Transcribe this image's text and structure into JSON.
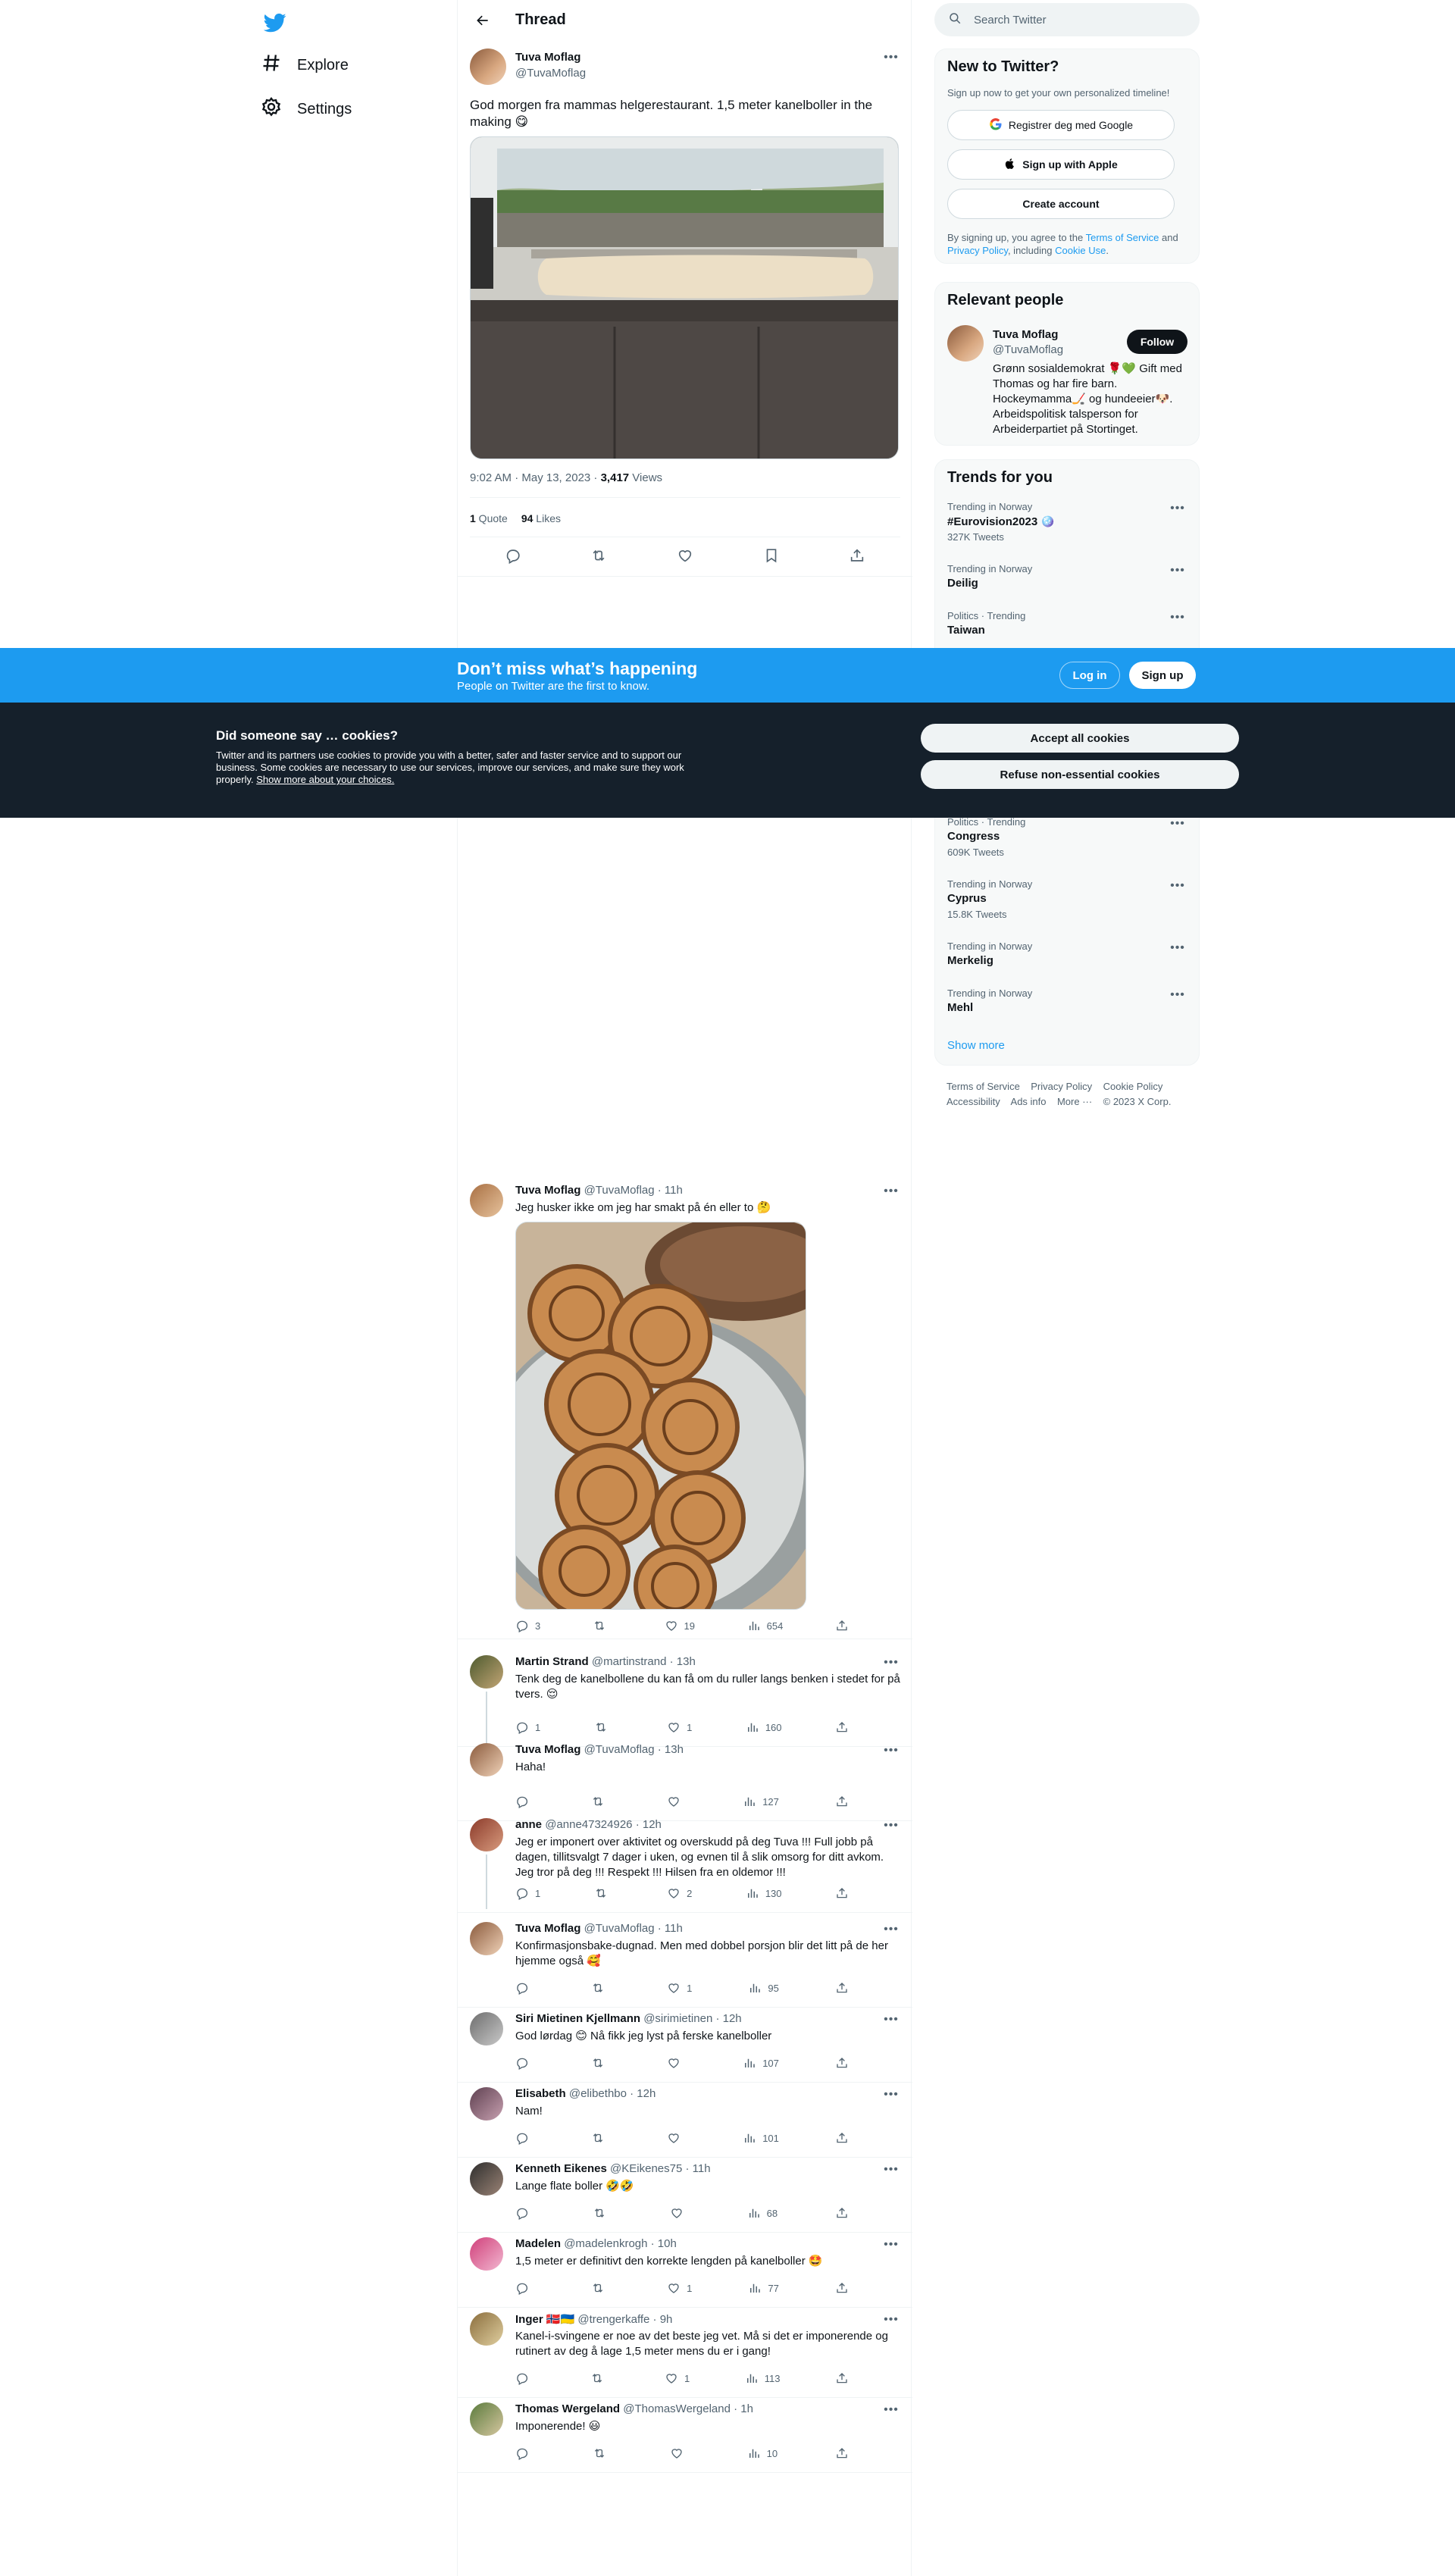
{
  "nav": {
    "explore": "Explore",
    "settings": "Settings"
  },
  "header": {
    "title": "Thread"
  },
  "main_tweet": {
    "name": "Tuva Moflag",
    "handle": "@TuvaMoflag",
    "text": "God morgen fra mammas helgerestaurant. 1,5 meter kanelboller in the making 😋",
    "timestamp": "9:02 AM · May 13, 2023 · ",
    "views_count": "3,417",
    "views_label": " Views",
    "quotes_count": "1",
    "quotes_label": " Quote",
    "likes_count": "94",
    "likes_label": " Likes"
  },
  "replies": [
    {
      "name": "Tuva Moflag",
      "meta": "@TuvaMoflag · 11h",
      "text": "Jeg husker ikke om jeg har smakt på én eller to 🤔",
      "reply": "3",
      "retweet": "",
      "like": "19",
      "views": "654"
    },
    {
      "name": "Martin Strand",
      "meta": "@martinstrand · 13h",
      "text": "Tenk deg de kanelbollene du kan få om du ruller langs benken i stedet for på tvers. 😌",
      "reply": "1",
      "retweet": "",
      "like": "1",
      "views": "160"
    },
    {
      "name": "Tuva Moflag",
      "meta": "@TuvaMoflag · 13h",
      "text": "Haha!",
      "reply": "",
      "retweet": "",
      "like": "",
      "views": "127"
    },
    {
      "name": "anne",
      "meta": "@anne47324926 · 12h",
      "text": "Jeg er imponert over aktivitet og overskudd på deg Tuva !!! Full jobb på dagen, tillitsvalgt 7 dager i uken, og evnen til å slik omsorg for ditt avkom. Jeg tror på deg !!! Respekt !!! Hilsen fra en oldemor !!!",
      "reply": "1",
      "retweet": "",
      "like": "2",
      "views": "130"
    },
    {
      "name": "Tuva Moflag",
      "meta": "@TuvaMoflag · 11h",
      "text": "Konfirmasjonsbake-dugnad. Men med dobbel porsjon blir det litt på de her hjemme også 🥰",
      "reply": "",
      "retweet": "",
      "like": "1",
      "views": "95"
    },
    {
      "name": "Siri Mietinen Kjellmann",
      "meta": "@sirimietinen · 12h",
      "text": "God lørdag 😊 Nå fikk jeg lyst på ferske kanelboller",
      "reply": "",
      "retweet": "",
      "like": "",
      "views": "107"
    },
    {
      "name": "Elisabeth",
      "meta": "@elibethbo · 12h",
      "text": "Nam!",
      "reply": "",
      "retweet": "",
      "like": "",
      "views": "101"
    },
    {
      "name": "Kenneth Eikenes",
      "meta": "@KEikenes75 · 11h",
      "text": "Lange flate boller 🤣🤣",
      "reply": "",
      "retweet": "",
      "like": "",
      "views": "68"
    },
    {
      "name": "Madelen",
      "meta": "@madelenkrogh · 10h",
      "text": "1,5 meter er definitivt den korrekte lengden på kanelboller 🤩",
      "reply": "",
      "retweet": "",
      "like": "1",
      "views": "77"
    },
    {
      "name": "Inger 🇳🇴🇺🇦",
      "meta": "@trengerkaffe · 9h",
      "text": "Kanel-i-svingene er noe av det beste jeg vet. Må si det er imponerende og rutinert av deg å lage 1,5 meter mens du er i gang!",
      "reply": "",
      "retweet": "",
      "like": "1",
      "views": "113"
    },
    {
      "name": "Thomas Wergeland",
      "meta": "@ThomasWergeland · 1h",
      "text": "Imponerende! 😃",
      "reply": "",
      "retweet": "",
      "like": "",
      "views": "10"
    }
  ],
  "search": {
    "placeholder": "Search Twitter"
  },
  "new_to_twitter": {
    "title": "New to Twitter?",
    "subtitle": "Sign up now to get your own personalized timeline!",
    "google_button": "Registrer deg med Google",
    "apple_button": "Sign up with Apple",
    "create_button": "Create account",
    "legal_prefix": "By signing up, you agree to the ",
    "terms": "Terms of Service",
    "and": " and ",
    "privacy": "Privacy Policy",
    "including": ", including ",
    "cookie_use": "Cookie Use",
    "period": "."
  },
  "relevant_people": {
    "title": "Relevant people",
    "name": "Tuva Moflag",
    "handle": "@TuvaMoflag",
    "follow": "Follow",
    "bio": "Grønn sosialdemokrat 🌹💚 Gift med Thomas og har fire barn. Hockeymamma🏒 og hundeeier🐶. Arbeidspolitisk talsperson for Arbeiderpartiet på Stortinget."
  },
  "trends": {
    "title": "Trends for you",
    "items": [
      {
        "meta": "Trending in Norway",
        "name": "#Eurovision2023 🪩",
        "count": "327K Tweets"
      },
      {
        "meta": "Trending in Norway",
        "name": "Deilig",
        "count": ""
      },
      {
        "meta": "Politics · Trending",
        "name": "Taiwan",
        "count": ""
      },
      {
        "meta": "Politics · Trending",
        "name": "Congress",
        "count": "609K Tweets"
      },
      {
        "meta": "Trending in Norway",
        "name": "Cyprus",
        "count": "15.8K Tweets"
      },
      {
        "meta": "Trending in Norway",
        "name": "Merkelig",
        "count": ""
      },
      {
        "meta": "Trending in Norway",
        "name": "Mehl",
        "count": ""
      }
    ],
    "show_more": "Show more"
  },
  "footer": {
    "links": [
      "Terms of Service",
      "Privacy Policy",
      "Cookie Policy",
      "Accessibility",
      "Ads info",
      "More ···"
    ],
    "copyright": "© 2023 X Corp."
  },
  "banner": {
    "title": "Don’t miss what’s happening",
    "subtitle": "People on Twitter are the first to know.",
    "login": "Log in",
    "signup": "Sign up"
  },
  "cookie": {
    "title": "Did someone say … cookies?",
    "body": "Twitter and its partners use cookies to provide you with a better, safer and faster service and to support our business. Some cookies are necessary to use our services, improve our services, and make sure they work properly. ",
    "link": "Show more about your choices.",
    "accept": "Accept all cookies",
    "refuse": "Refuse non-essential cookies"
  },
  "colors": {
    "accent": "#1d9bf0",
    "cookie_bg": "#15202b",
    "text": "#0f1419",
    "muted": "#536471"
  }
}
